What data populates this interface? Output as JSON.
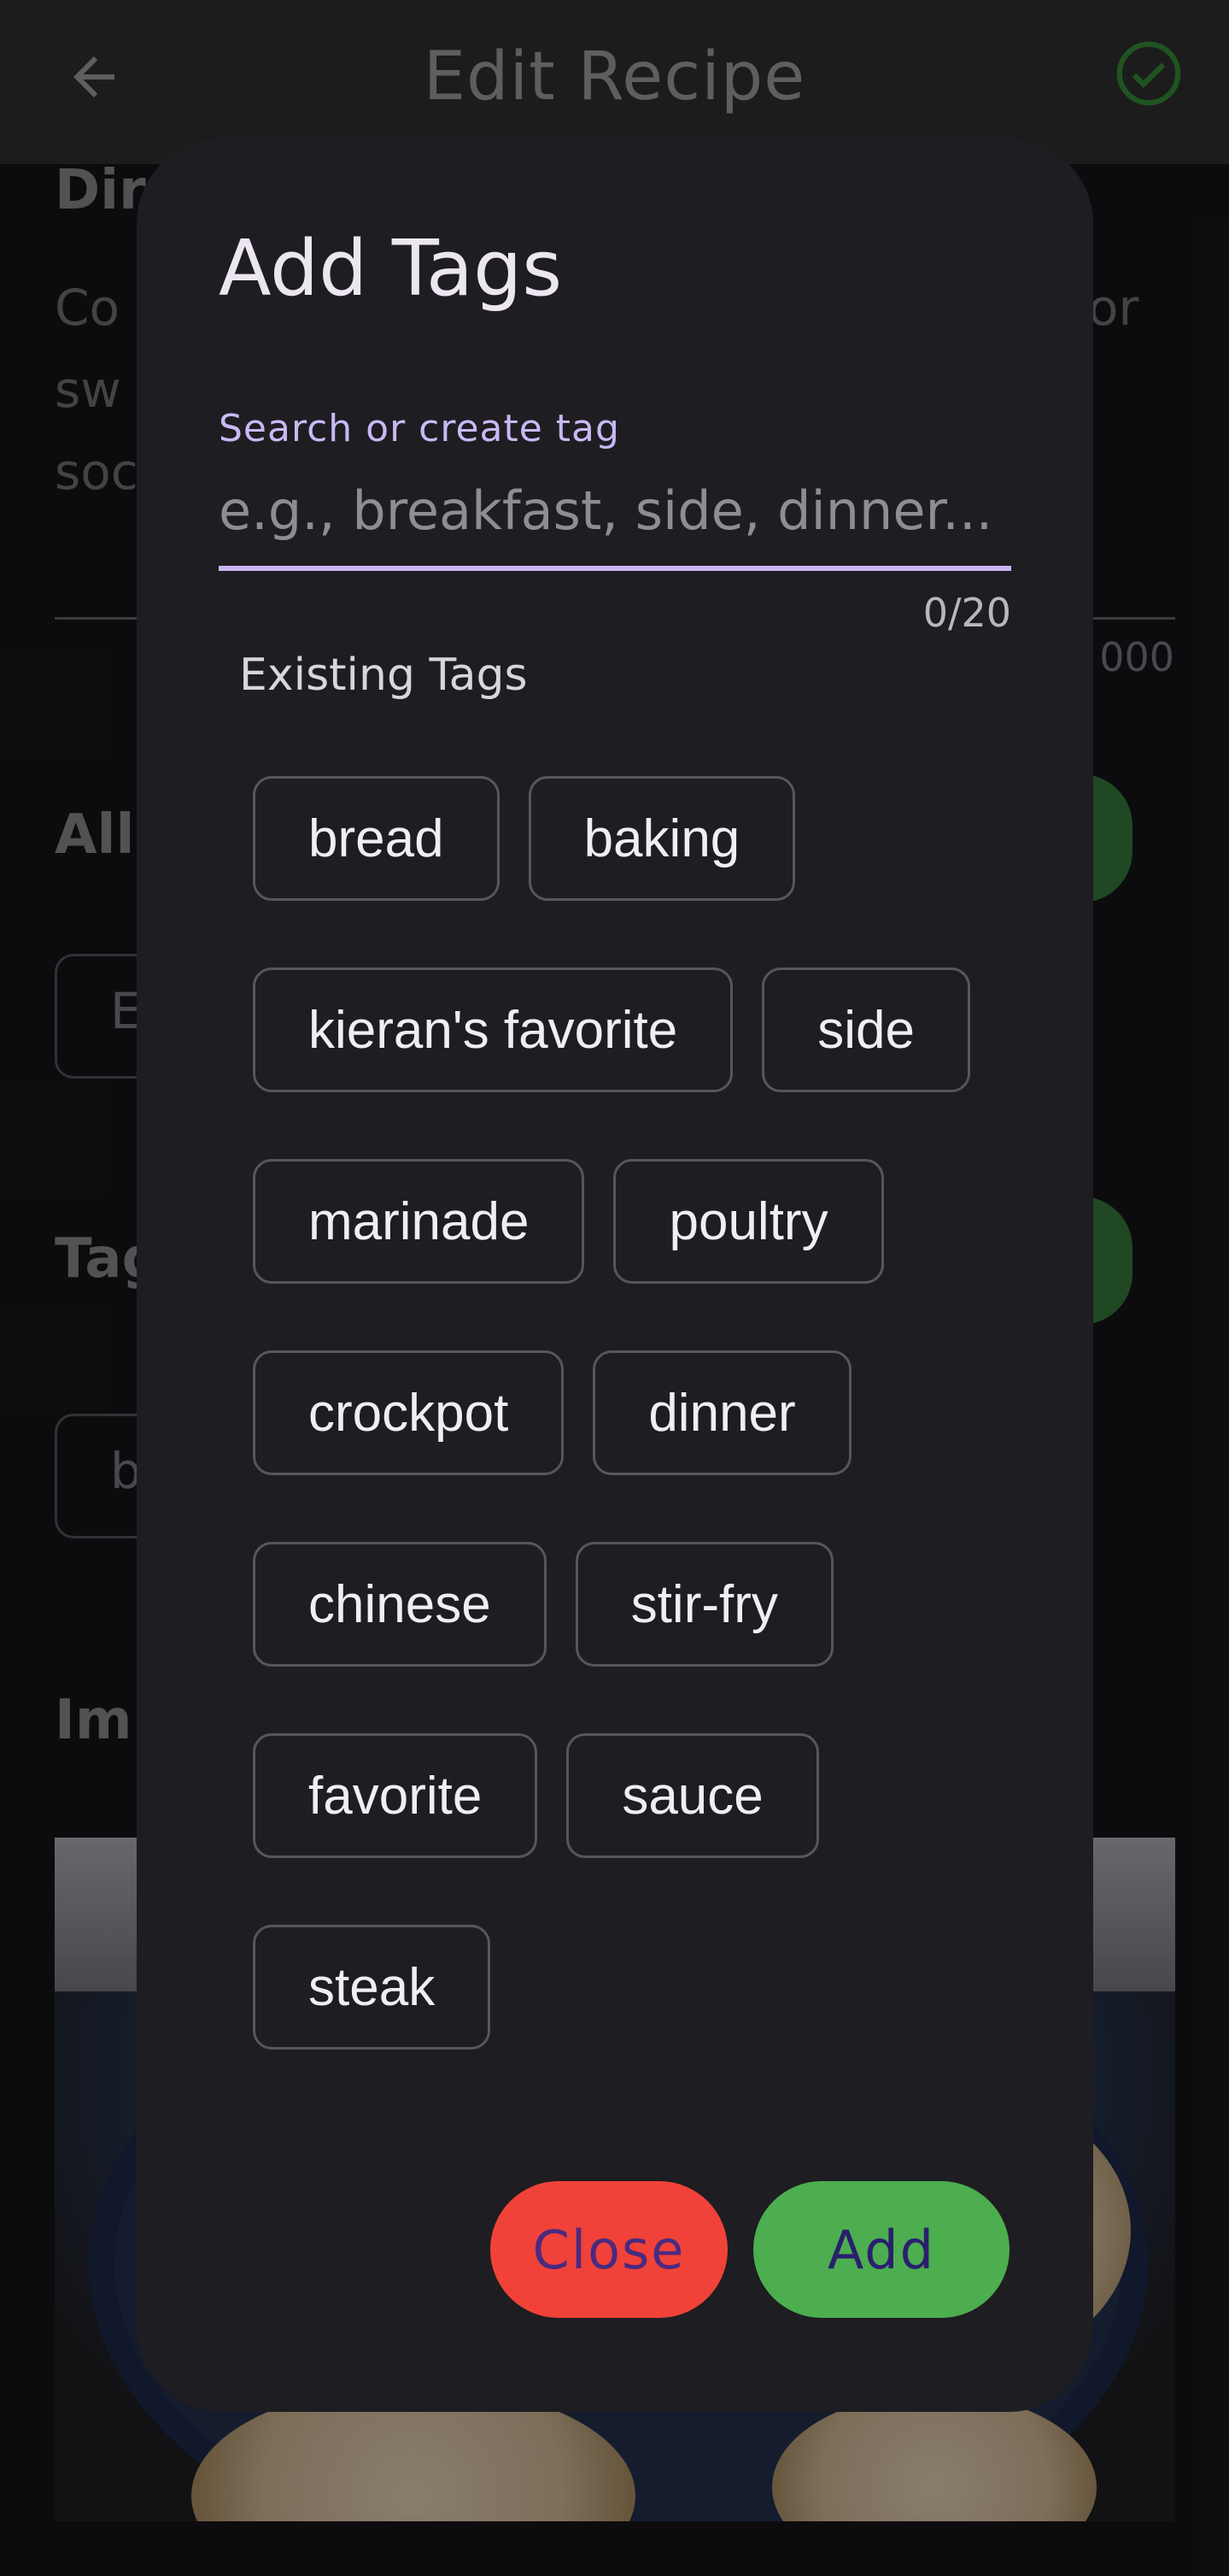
{
  "appbar": {
    "title": "Edit Recipe",
    "back_icon": "arrow-left-icon",
    "confirm_icon": "check-circle-icon",
    "accent_color": "#2e7d32"
  },
  "background": {
    "section_directions": "Dir",
    "directions_lines": [
      "Co",
      "sw",
      "soc"
    ],
    "directions_tail": "or",
    "char_counter": "000",
    "section_allergens": "All",
    "allergen_chip": "E",
    "section_tags": "Tag",
    "tag_chip": "b",
    "section_images": "Im"
  },
  "dialog": {
    "title": "Add Tags",
    "search": {
      "label": "Search or create tag",
      "placeholder": "e.g., breakfast, side, dinner...",
      "value": "",
      "counter": "0/20",
      "accent_color": "#c9b8f5"
    },
    "existing_label": "Existing Tags",
    "tag_rows": [
      [
        "bread",
        "baking"
      ],
      [
        "kieran's favorite",
        "side"
      ],
      [
        "marinade",
        "poultry"
      ],
      [
        "crockpot",
        "dinner"
      ],
      [
        "chinese",
        "stir-fry"
      ],
      [
        "favorite",
        "sauce"
      ],
      [
        "steak"
      ]
    ],
    "close_label": "Close",
    "add_label": "Add",
    "close_color": "#f04238",
    "add_color": "#4cae4f"
  }
}
